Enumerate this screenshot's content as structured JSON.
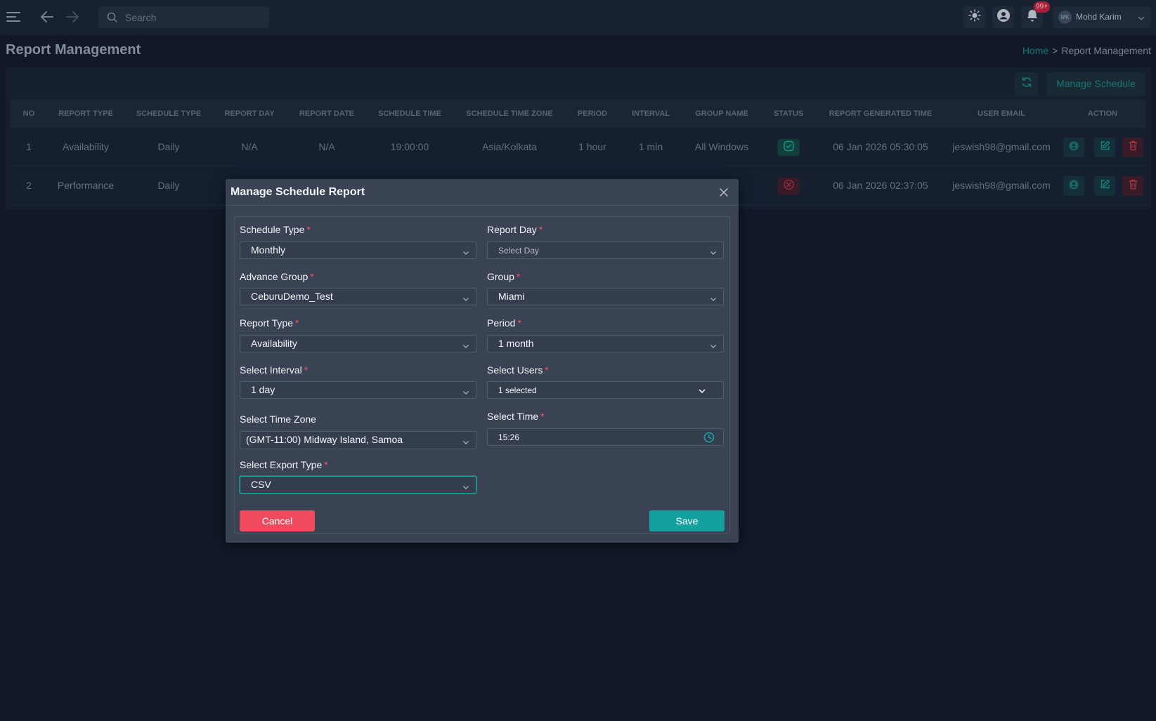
{
  "topbar": {
    "search_placeholder": "Search",
    "notification_badge": "99+",
    "user_initials": "MK",
    "user_name": "Mohd Karim"
  },
  "page": {
    "title": "Report Management",
    "breadcrumb_home": "Home",
    "breadcrumb_sep": ">",
    "breadcrumb_current": "Report Management",
    "manage_schedule_label": "Manage Schedule"
  },
  "table": {
    "headers": [
      "NO",
      "REPORT TYPE",
      "SCHEDULE TYPE",
      "REPORT DAY",
      "REPORT DATE",
      "SCHEDULE TIME",
      "SCHEDULE TIME ZONE",
      "PERIOD",
      "INTERVAL",
      "GROUP NAME",
      "STATUS",
      "REPORT GENERATED TIME",
      "USER EMAIL",
      "ACTION"
    ],
    "rows": [
      {
        "no": "1",
        "report_type": "Availability",
        "schedule_type": "Daily",
        "report_day": "N/A",
        "report_date": "N/A",
        "schedule_time": "19:00:00",
        "time_zone": "Asia/Kolkata",
        "period": "1 hour",
        "interval": "1 min",
        "group_name": "All Windows",
        "status": "active",
        "generated_time": "06 Jan 2026 05:30:05",
        "email": "jeswish98@gmail.com"
      },
      {
        "no": "2",
        "report_type": "Performance",
        "schedule_type": "Daily",
        "report_day": "",
        "report_date": "",
        "schedule_time": "",
        "time_zone": "",
        "period": "",
        "interval": "",
        "group_name": "",
        "status": "inactive",
        "generated_time": "06 Jan 2026 02:37:05",
        "email": "jeswish98@gmail.com"
      }
    ]
  },
  "modal": {
    "title": "Manage Schedule Report",
    "required_mark": "*",
    "schedule_type_label": "Schedule Type",
    "schedule_type_value": "Monthly",
    "report_day_label": "Report Day",
    "report_day_placeholder": "Select Day",
    "advance_group_label": "Advance Group",
    "advance_group_value": "CeburuDemo_Test",
    "group_label": "Group",
    "group_value": "Miami",
    "report_type_label": "Report Type",
    "report_type_value": "Availability",
    "period_label": "Period",
    "period_value": "1 month",
    "interval_label": "Select Interval",
    "interval_value": "1 day",
    "users_label": "Select Users",
    "users_value": "1 selected",
    "time_zone_label": "Select Time Zone",
    "time_zone_value": "(GMT-11:00) Midway Island, Samoa",
    "time_label": "Select Time",
    "time_value": "15:26",
    "export_type_label": "Select Export Type",
    "export_type_value": "CSV",
    "cancel_label": "Cancel",
    "save_label": "Save"
  },
  "colors": {
    "accent": "#14a19d",
    "danger": "#f04a5e",
    "background": "#121a2a",
    "modal": "#3a4354"
  }
}
